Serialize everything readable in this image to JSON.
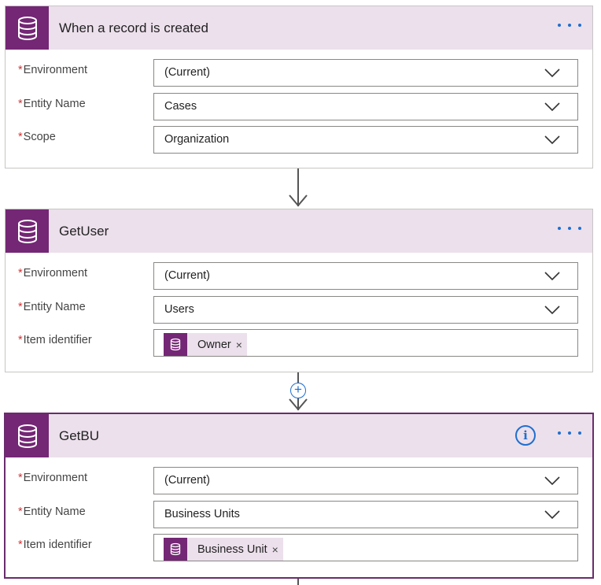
{
  "colors": {
    "accent": "#742774",
    "header_bg": "#ece0ec",
    "link_blue": "#1f6fd0",
    "required": "#d13438"
  },
  "icons": {
    "connector": "database-icon",
    "more": "more-dots-icon",
    "dropdown": "chevron-down-icon",
    "info": "info-icon",
    "add": "add-step-icon",
    "remove": "close-icon"
  },
  "cards": {
    "trigger": {
      "title": "When a record is created",
      "fields": [
        {
          "required": "*",
          "label": "Environment",
          "value": "(Current)"
        },
        {
          "required": "*",
          "label": "Entity Name",
          "value": "Cases"
        },
        {
          "required": "*",
          "label": "Scope",
          "value": "Organization"
        }
      ]
    },
    "getuser": {
      "title": "GetUser",
      "fields": [
        {
          "required": "*",
          "label": "Environment",
          "value": "(Current)"
        },
        {
          "required": "*",
          "label": "Entity Name",
          "value": "Users"
        },
        {
          "required": "*",
          "label": "Item identifier",
          "token": "Owner",
          "remove": "×"
        }
      ]
    },
    "getbu": {
      "title": "GetBU",
      "info": "i",
      "fields": [
        {
          "required": "*",
          "label": "Environment",
          "value": "(Current)"
        },
        {
          "required": "*",
          "label": "Entity Name",
          "value": "Business Units"
        },
        {
          "required": "*",
          "label": "Item identifier",
          "token": "Business Unit",
          "remove": "×"
        }
      ]
    }
  },
  "add_step": {
    "symbol": "+"
  }
}
